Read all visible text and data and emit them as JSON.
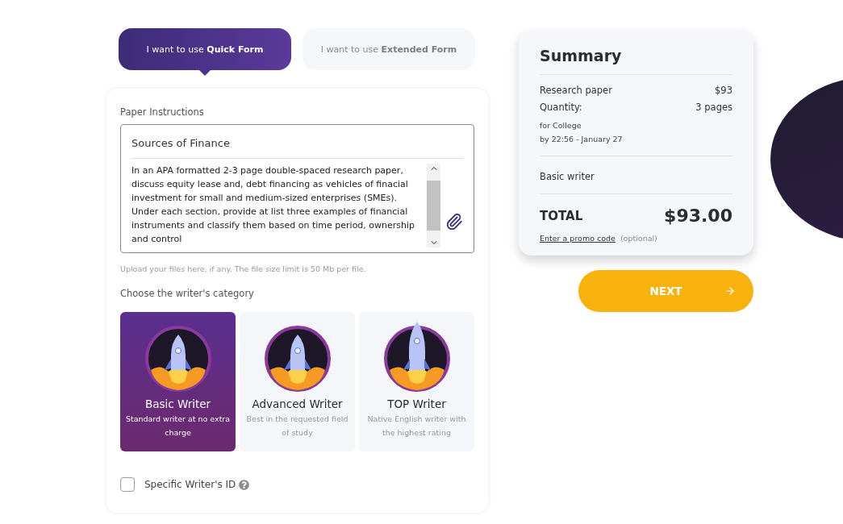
{
  "form_tabs": [
    {
      "label": "I want to use **Quick Form**",
      "selected": true
    },
    {
      "label": "I want to use **Extended Form**",
      "selected": false
    }
  ],
  "instructions": {
    "label": "Paper Instructions",
    "title": "Sources of Finance",
    "body": "In an APA formatted 2-3 page double-spaced research paper, discuss equity lease and, debt financing as vehicles of finacial investment for small and medium-sized enterprises (SMEs). Under each section, provide at list three examples of financial instruments and classify them based on time period, ownership and control",
    "upload_hint": "Upload your files here, if any. The file size limit is 50 Mb per file."
  },
  "writer_category": {
    "label": "Choose the writer's category",
    "options": [
      {
        "name": "Basic Writer",
        "description": "Standard writer at no extra charge",
        "selected": true
      },
      {
        "name": "Advanced Writer",
        "description": "Best in the requested field of study",
        "selected": false
      },
      {
        "name": "TOP Writer",
        "description": "Native English writer with the highest rating",
        "selected": false
      }
    ]
  },
  "specific_writer": {
    "label": "Specific Writer's ID",
    "checked": false
  },
  "summary": {
    "title": "Summary",
    "rows": [
      {
        "label": "Research paper",
        "value": "$93"
      },
      {
        "label": "Quantity:",
        "value": "3 pages"
      }
    ],
    "details": [
      "for College",
      "by 22:56 - January 27"
    ],
    "writer": "Basic writer",
    "total_label": "TOTAL",
    "total": "$93.00",
    "promo_link": "Enter a promo code",
    "promo_note": "(optional)"
  },
  "next_button": "NEXT"
}
